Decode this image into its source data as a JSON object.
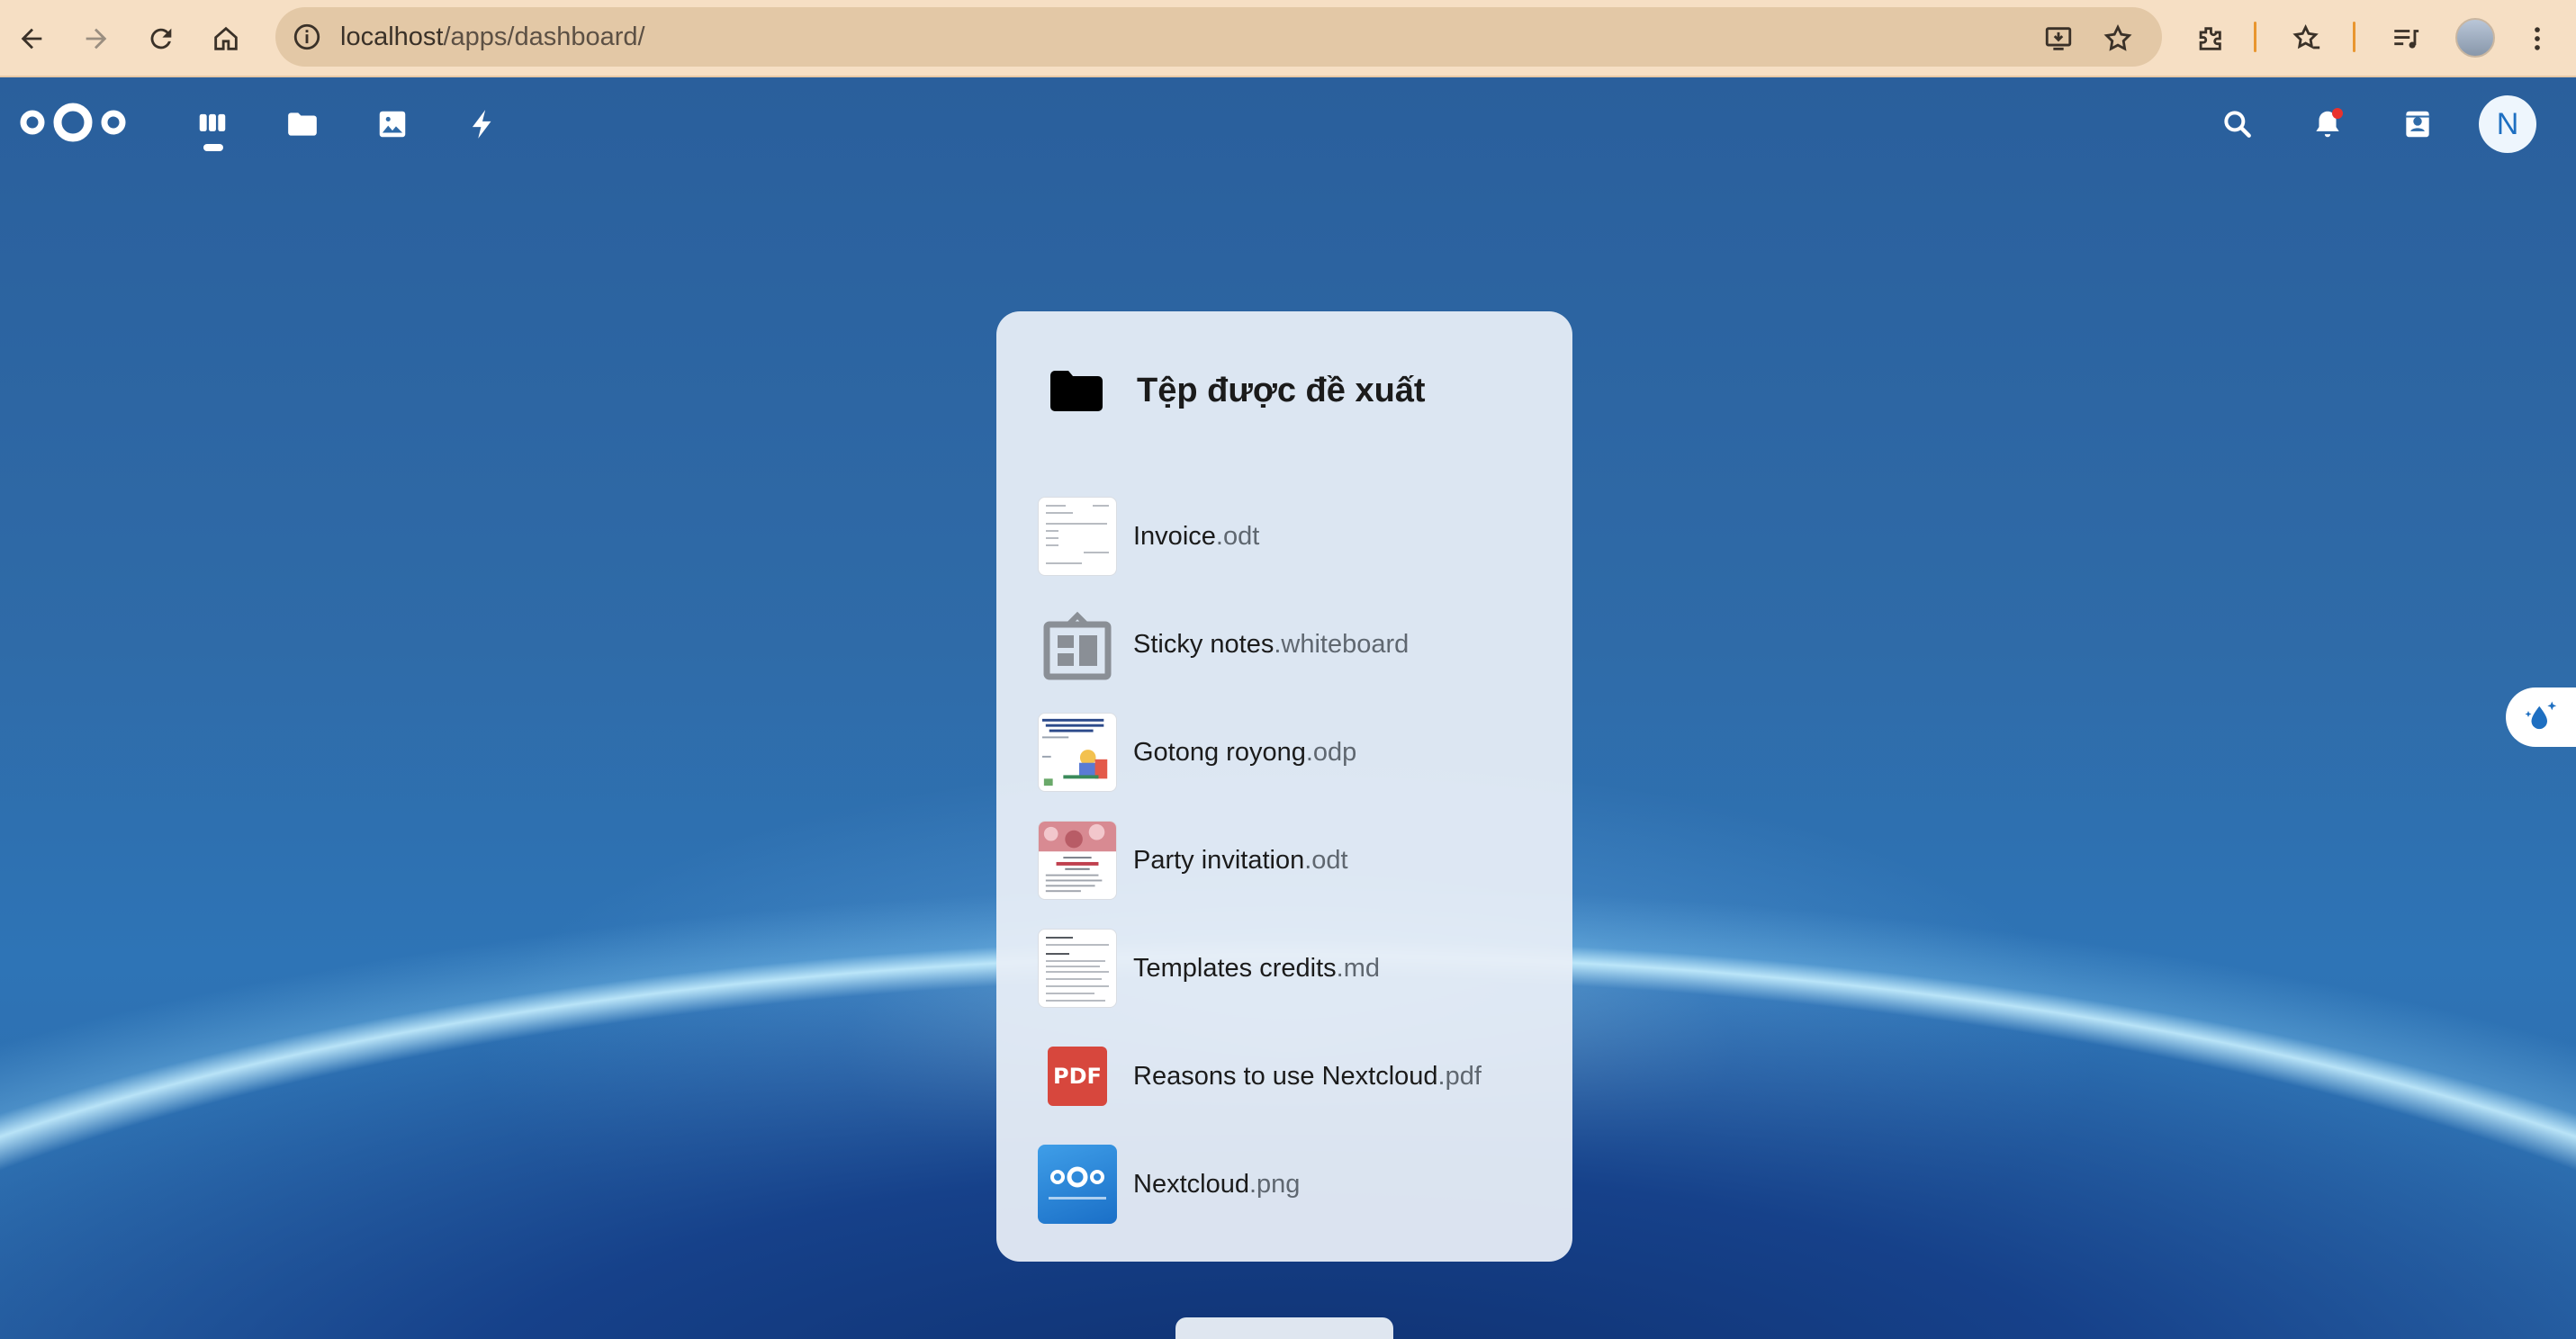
{
  "browser": {
    "url_host": "localhost",
    "url_path": "/apps/dashboard/",
    "buttons": [
      "back-icon",
      "forward-icon",
      "reload-icon",
      "home-icon",
      "install-app-icon",
      "bookmark-star-icon",
      "extensions-icon",
      "bookmarks-icon",
      "media-control-icon",
      "menu-icon"
    ]
  },
  "header": {
    "apps": [
      {
        "name": "dashboard",
        "icon": "dashboard-icon"
      },
      {
        "name": "files",
        "icon": "folder-icon"
      },
      {
        "name": "photos",
        "icon": "image-icon"
      },
      {
        "name": "activity",
        "icon": "lightning-icon"
      }
    ],
    "avatar_initial": "N"
  },
  "widget": {
    "title": "Tệp được đề xuất",
    "files": [
      {
        "base": "Invoice",
        "ext": ".odt",
        "thumb": "document"
      },
      {
        "base": "Sticky notes",
        "ext": ".whiteboard",
        "thumb": "whiteboard-icon"
      },
      {
        "base": "Gotong royong",
        "ext": ".odp",
        "thumb": "presentation"
      },
      {
        "base": "Party invitation",
        "ext": ".odt",
        "thumb": "invitation"
      },
      {
        "base": "Templates credits",
        "ext": ".md",
        "thumb": "document"
      },
      {
        "base": "Reasons to use Nextcloud",
        "ext": ".pdf",
        "thumb": "pdf-icon"
      },
      {
        "base": "Nextcloud",
        "ext": ".png",
        "thumb": "nextcloud-image"
      }
    ]
  },
  "pdf_badge": "PDF",
  "colors": {
    "browser_bar": "#f6dfc4",
    "url_pill": "#e3c8a6",
    "background_blue": "#2f6ba8",
    "widget_bg": "#e8eef6",
    "pdf_red": "#d7473d",
    "accent_blue": "#1e6fc1"
  }
}
